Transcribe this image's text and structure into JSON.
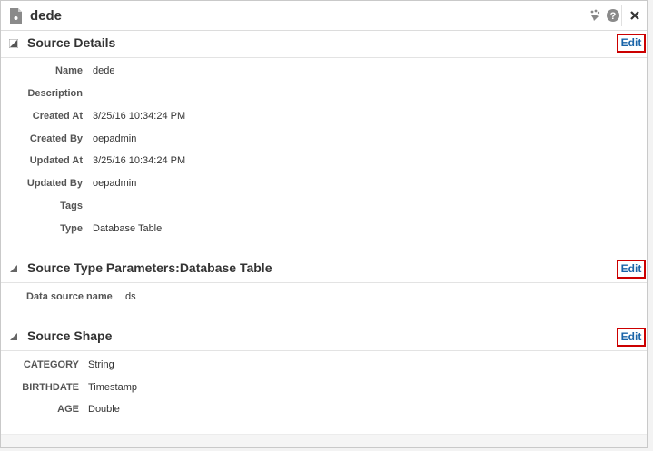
{
  "window": {
    "title": "dede"
  },
  "sections": {
    "details": {
      "title": "Source Details",
      "edit_label": "Edit",
      "fields": [
        {
          "label": "Name",
          "value": "dede"
        },
        {
          "label": "Description",
          "value": ""
        },
        {
          "label": "Created At",
          "value": "3/25/16 10:34:24 PM"
        },
        {
          "label": "Created By",
          "value": "oepadmin"
        },
        {
          "label": "Updated At",
          "value": "3/25/16 10:34:24 PM"
        },
        {
          "label": "Updated By",
          "value": "oepadmin"
        },
        {
          "label": "Tags",
          "value": ""
        },
        {
          "label": "Type",
          "value": "Database Table"
        }
      ]
    },
    "params": {
      "title": "Source Type Parameters:Database Table",
      "edit_label": "Edit",
      "fields": [
        {
          "label": "Data source name",
          "value": "ds"
        }
      ]
    },
    "shape": {
      "title": "Source Shape",
      "edit_label": "Edit",
      "fields": [
        {
          "label": "CATEGORY",
          "value": "String"
        },
        {
          "label": "BIRTHDATE",
          "value": "Timestamp"
        },
        {
          "label": "AGE",
          "value": "Double"
        }
      ]
    }
  },
  "icons": {
    "title": "document-icon",
    "toolbar": [
      "bird-icon",
      "help-icon",
      "close-icon"
    ],
    "disclosure": "triangle-collapse-icon"
  }
}
